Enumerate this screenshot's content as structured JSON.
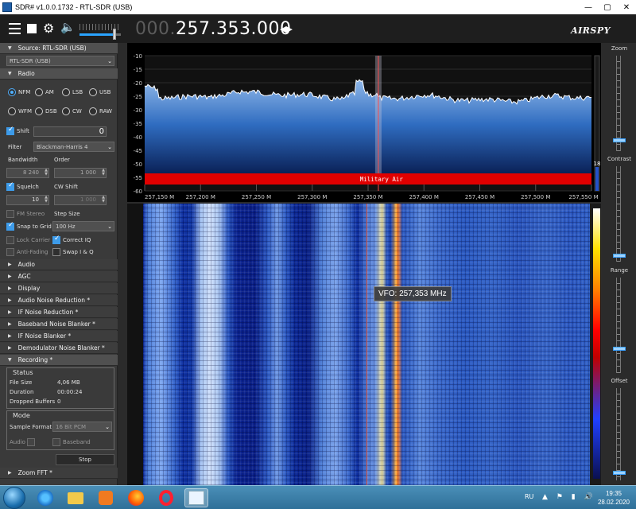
{
  "window": {
    "title": "SDR# v1.0.0.1732 - RTL-SDR (USB)",
    "min_glyph": "—",
    "max_glyph": "▢",
    "close_glyph": "✕"
  },
  "toolbar": {
    "freq_dim": "000.",
    "freq_bright": "257.353.000",
    "step_arrows": "◀▶",
    "brand": "AIRSPY",
    "volume": 0.85
  },
  "source": {
    "header": "Source: RTL-SDR (USB)",
    "device": "RTL-SDR (USB)"
  },
  "radio": {
    "header": "Radio",
    "modes": [
      "NFM",
      "AM",
      "LSB",
      "USB",
      "WFM",
      "DSB",
      "CW",
      "RAW"
    ],
    "selected_mode": "NFM",
    "shift_label": "Shift",
    "shift_value": "0",
    "filter_label": "Filter",
    "filter_value": "Blackman-Harris 4",
    "bandwidth_label": "Bandwidth",
    "bandwidth_value": "8 240",
    "order_label": "Order",
    "order_value": "1 000",
    "squelch_label": "Squelch",
    "squelch_value": "10",
    "cw_shift_label": "CW Shift",
    "cw_shift_value": "1 000",
    "fm_stereo_label": "FM Stereo",
    "step_size_label": "Step Size",
    "snap_label": "Snap to Grid",
    "step_value": "100 Hz",
    "lock_carrier_label": "Lock Carrier",
    "correct_iq_label": "Correct IQ",
    "anti_fading_label": "Anti-Fading",
    "swap_iq_label": "Swap I & Q"
  },
  "collapsed_sections": [
    "Audio",
    "AGC",
    "Display",
    "Audio Noise Reduction *",
    "IF Noise Reduction *",
    "Baseband Noise Blanker *",
    "IF Noise Blanker *",
    "Demodulator Noise Blanker *"
  ],
  "recording": {
    "header": "Recording *",
    "status_title": "Status",
    "file_size_label": "File Size",
    "file_size_value": "4,06 MB",
    "duration_label": "Duration",
    "duration_value": "00:00:24",
    "dropped_label": "Dropped Buffers",
    "dropped_value": "0",
    "mode_title": "Mode",
    "sample_format_label": "Sample Format",
    "sample_format_value": "16 Bit PCM",
    "audio_label": "Audio",
    "baseband_label": "Baseband",
    "stop_label": "Stop"
  },
  "zoom_fft": {
    "header": "Zoom FFT *"
  },
  "spectrum": {
    "db_ticks": [
      "-10",
      "-15",
      "-20",
      "-25",
      "-30",
      "-35",
      "-40",
      "-45",
      "-50",
      "-55",
      "-60"
    ],
    "freq_ticks": [
      "257,150 M",
      "257,200 M",
      "257,250 M",
      "257,300 M",
      "257,350 M",
      "257,400 M",
      "257,450 M",
      "257,500 M",
      "257,550 M"
    ],
    "band_label": "Military Air",
    "level_value": "18",
    "colors": {
      "band": "#e00000",
      "fill_top": "#8fb7e8",
      "fill_bottom": "#06184a"
    }
  },
  "waterfall": {
    "vfo_tooltip": "VFO: 257,353 MHz"
  },
  "right_panel": {
    "zoom_label": "Zoom",
    "contrast_label": "Contrast",
    "range_label": "Range",
    "offset_label": "Offset"
  },
  "taskbar": {
    "apps": [
      "start-orb",
      "ie-icon",
      "folder-icon",
      "media-player-icon",
      "firefox-icon",
      "opera-icon",
      "sdrsharp-icon"
    ],
    "lang": "RU",
    "tray_icons": "▲ ⚑ ▮ 🔊",
    "time": "19:35",
    "date": "28.02.2020"
  }
}
